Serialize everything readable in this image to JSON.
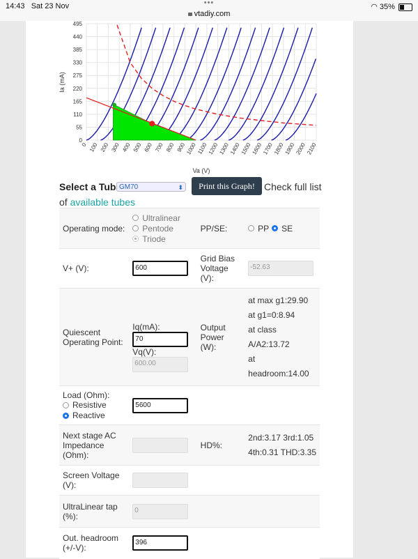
{
  "status_bar": {
    "time": "14:43",
    "date": "Sat 23 Nov",
    "url": "vtadiy.com",
    "battery": "35%"
  },
  "chart_data": {
    "type": "line",
    "xlabel": "Va (V)",
    "ylabel": "Ia (mA)",
    "xlim": [
      0,
      2100
    ],
    "ylim": [
      0,
      495
    ],
    "x_ticks": [
      "0",
      "100",
      "200",
      "300",
      "400",
      "500",
      "600",
      "700",
      "800",
      "900",
      "1000",
      "1100",
      "1200",
      "1300",
      "1400",
      "1500",
      "1600",
      "1700",
      "1800",
      "1900",
      "2000",
      "2100"
    ],
    "y_ticks": [
      "0",
      "55",
      "110",
      "165",
      "220",
      "275",
      "330",
      "385",
      "440",
      "495"
    ],
    "grid": true,
    "series": [
      {
        "kind": "plate-curves",
        "color": "#1a1aa8",
        "curve_count": 15,
        "curve_spacing_v": 130,
        "curve_shape": "triode family, steep near origin"
      },
      {
        "kind": "max-dissipation-hyperbola",
        "color": "#e02020",
        "style": "dashed",
        "x": [
          280,
          400,
          500,
          600,
          700,
          800,
          900,
          1000,
          1200,
          1400,
          1600,
          1800,
          2000,
          2100
        ],
        "y": [
          490,
          330,
          264,
          220,
          189,
          165,
          147,
          132,
          110,
          94,
          83,
          73,
          66,
          63
        ]
      },
      {
        "kind": "load-line",
        "color": "#e02020",
        "x": [
          0,
          1000
        ],
        "y": [
          180,
          0
        ]
      }
    ],
    "operating_point": {
      "x": 600,
      "y": 70,
      "color": "#e02020"
    },
    "swing_region": {
      "color": "#00e600",
      "outline": "#22aa22",
      "x": [
        245,
        245,
        255,
        600,
        1000,
        990,
        600,
        245
      ],
      "y": [
        0,
        145,
        150,
        70,
        0,
        0,
        0,
        0
      ]
    }
  },
  "selector": {
    "label": "Select a Tube:",
    "value": "GM70",
    "print_button": "Print this Graph!",
    "check_text": "Check full list",
    "of_text": "of",
    "link_text": "available tubes"
  },
  "form": {
    "operating_mode_label": "Operating mode:",
    "modes": [
      "Ultralinear",
      "Pentode",
      "Triode"
    ],
    "selected_mode": "Triode",
    "pp_se_label": "PP/SE:",
    "pp_label": "PP",
    "se_label": "SE",
    "vplus_label": "V+ (V):",
    "vplus_value": "600",
    "grid_bias_label": "Grid Bias Voltage (V):",
    "grid_bias_value": "-52.63",
    "quiescent_label": "Quiescent Operating Point:",
    "iq_label": "Iq(mA):",
    "iq_value": "70",
    "vq_label": "Vq(V):",
    "vq_value": "600.00",
    "output_power_label": "Output Power (W):",
    "power_max_g1": "at max g1:29.90",
    "power_g1_0": "at g1=0:8.94",
    "power_class_a": "at class",
    "power_class_b": "A/A2:13.72",
    "power_headroom_a": "at",
    "power_headroom_b": "headroom:14.00",
    "load_label": "Load (Ohm):",
    "load_resistive": "Resistive",
    "load_reactive": "Reactive",
    "load_value": "5600",
    "next_stage_label": "Next stage AC Impedance (Ohm):",
    "hd_label": "HD%:",
    "hd_line1": "2nd:3.17 3rd:1.05",
    "hd_line2": "4th:0.31 THD:3.35",
    "screen_voltage_label": "Screen Voltage (V):",
    "ultralinear_tap_label": "UltraLinear tap (%):",
    "ultralinear_tap_value": "0",
    "headroom_label": "Out. headroom (+/-V):",
    "headroom_value": "396"
  },
  "colors": {
    "curves": "#1a1aa8",
    "red": "#e02020",
    "green": "#00e600",
    "button_bg": "#2f3e4c",
    "link": "#1ca3a3",
    "radio_on": "#1a73e8"
  }
}
